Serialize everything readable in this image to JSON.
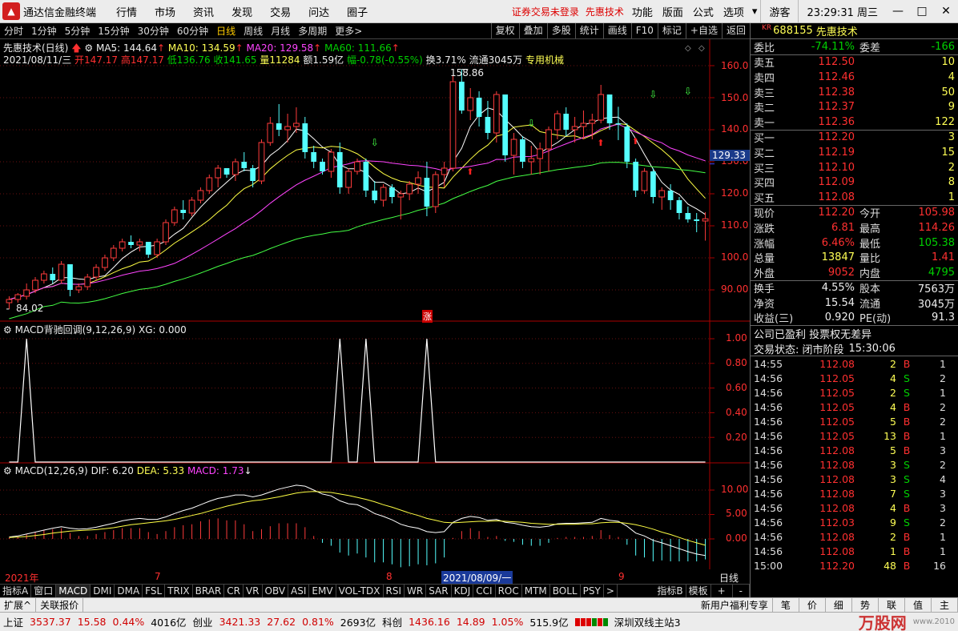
{
  "menubar": {
    "app_name": "通达信金融终端",
    "menus": [
      "行情",
      "市场",
      "资讯",
      "发现",
      "交易",
      "问达",
      "圈子"
    ],
    "warning": "证券交易未登录",
    "stock_name": "先惠技术",
    "tools": [
      "功能",
      "版面",
      "公式",
      "选项"
    ],
    "user": "游客",
    "clock": "23:29:31 周三"
  },
  "chartbar": {
    "periods": [
      "分时",
      "1分钟",
      "5分钟",
      "15分钟",
      "30分钟",
      "60分钟",
      "日线",
      "周线",
      "月线",
      "多周期",
      "更多>"
    ],
    "active_period": "日线",
    "buttons": [
      "复权",
      "叠加",
      "多股",
      "统计",
      "画线",
      "F10",
      "标记",
      "+自选",
      "返回"
    ]
  },
  "main": {
    "title": "先惠技术(日线)",
    "ma5": "MA5: 144.64",
    "ma10": "MA10: 134.59",
    "ma20": "MA20: 129.58",
    "ma60": "MA60: 111.66",
    "quote_date": "2021/08/11/三",
    "open": "开147.17",
    "high": "高147.17",
    "low": "低136.76",
    "close": "收141.65",
    "volume": "量11284",
    "amount": "额1.59亿",
    "change": "幅-0.78(-0.55%)",
    "turnover": "换3.71%",
    "float": "流通3045万",
    "industry": "专用机械",
    "high_mark": "158.86",
    "low_mark": "84.02",
    "rise_mark": "涨",
    "price_axis": [
      "160.0",
      "150.0",
      "140.0",
      "130.0",
      "120.0",
      "110.0",
      "100.0",
      "90.00"
    ],
    "price_tag": "129.33"
  },
  "ind1": {
    "title": "MACD背驰回调(9,12,26,9) XG: 0.000",
    "axis": [
      "1.00",
      "0.80",
      "0.60",
      "0.40",
      "0.20"
    ]
  },
  "ind2": {
    "title": "MACD(12,26,9)",
    "dif": "DIF: 6.20",
    "dea": "DEA: 5.33",
    "macd": "MACD: 1.73",
    "axis": [
      "10.00",
      "5.00",
      "0.00"
    ]
  },
  "xaxis": {
    "labels": [
      "2021年",
      "7",
      "8",
      "9"
    ],
    "cursor_date": "2021/08/09/一",
    "period_label": "日线"
  },
  "rpanel": {
    "code": "688155",
    "name": "先惠技术",
    "kr": "KR",
    "weibi_label": "委比",
    "weibi": "-74.11%",
    "weicha_label": "委差",
    "weicha": "-166",
    "asks": [
      {
        "label": "卖五",
        "price": "112.50",
        "vol": "10"
      },
      {
        "label": "卖四",
        "price": "112.46",
        "vol": "4"
      },
      {
        "label": "卖三",
        "price": "112.38",
        "vol": "50"
      },
      {
        "label": "卖二",
        "price": "112.37",
        "vol": "9"
      },
      {
        "label": "卖一",
        "price": "112.36",
        "vol": "122"
      }
    ],
    "bids": [
      {
        "label": "买一",
        "price": "112.20",
        "vol": "3"
      },
      {
        "label": "买二",
        "price": "112.19",
        "vol": "15"
      },
      {
        "label": "买三",
        "price": "112.10",
        "vol": "2"
      },
      {
        "label": "买四",
        "price": "112.09",
        "vol": "8"
      },
      {
        "label": "买五",
        "price": "112.08",
        "vol": "1"
      }
    ],
    "stats": [
      {
        "l": "现价",
        "v": "112.20",
        "vc": "red",
        "l2": "今开",
        "v2": "105.98",
        "v2c": "red"
      },
      {
        "l": "涨跌",
        "v": "6.81",
        "vc": "red",
        "l2": "最高",
        "v2": "114.26",
        "v2c": "red"
      },
      {
        "l": "涨幅",
        "v": "6.46%",
        "vc": "red",
        "l2": "最低",
        "v2": "105.38",
        "v2c": "green"
      },
      {
        "l": "总量",
        "v": "13847",
        "vc": "yellow",
        "l2": "量比",
        "v2": "1.41",
        "v2c": "red"
      },
      {
        "l": "外盘",
        "v": "9052",
        "vc": "red",
        "l2": "内盘",
        "v2": "4795",
        "v2c": "green"
      }
    ],
    "stats2": [
      {
        "l": "换手",
        "v": "4.55%",
        "l2": "股本",
        "v2": "7563万"
      },
      {
        "l": "净资",
        "v": "15.54",
        "l2": "流通",
        "v2": "3045万"
      },
      {
        "l": "收益(三)",
        "v": "0.920",
        "l2": "PE(动)",
        "v2": "91.3"
      }
    ],
    "notice": "公司已盈利 投票权无差异",
    "status_label": "交易状态: 闭市阶段",
    "status_time": "15:30:06",
    "trades": [
      {
        "t": "14:55",
        "p": "112.08",
        "q": "2",
        "bs": "B",
        "n": "1"
      },
      {
        "t": "14:56",
        "p": "112.05",
        "q": "4",
        "bs": "S",
        "n": "2"
      },
      {
        "t": "14:56",
        "p": "112.05",
        "q": "2",
        "bs": "S",
        "n": "1"
      },
      {
        "t": "14:56",
        "p": "112.05",
        "q": "4",
        "bs": "B",
        "n": "2"
      },
      {
        "t": "14:56",
        "p": "112.05",
        "q": "5",
        "bs": "B",
        "n": "2"
      },
      {
        "t": "14:56",
        "p": "112.05",
        "q": "13",
        "bs": "B",
        "n": "1"
      },
      {
        "t": "14:56",
        "p": "112.08",
        "q": "5",
        "bs": "B",
        "n": "3"
      },
      {
        "t": "14:56",
        "p": "112.08",
        "q": "3",
        "bs": "S",
        "n": "2"
      },
      {
        "t": "14:56",
        "p": "112.08",
        "q": "3",
        "bs": "S",
        "n": "4"
      },
      {
        "t": "14:56",
        "p": "112.08",
        "q": "7",
        "bs": "S",
        "n": "3"
      },
      {
        "t": "14:56",
        "p": "112.08",
        "q": "4",
        "bs": "B",
        "n": "3"
      },
      {
        "t": "14:56",
        "p": "112.03",
        "q": "9",
        "bs": "S",
        "n": "2"
      },
      {
        "t": "14:56",
        "p": "112.08",
        "q": "2",
        "bs": "B",
        "n": "1"
      },
      {
        "t": "14:56",
        "p": "112.08",
        "q": "1",
        "bs": "B",
        "n": "1"
      },
      {
        "t": "15:00",
        "p": "112.20",
        "q": "48",
        "bs": "B",
        "n": "16"
      }
    ]
  },
  "tabs": {
    "items": [
      "指标A",
      "窗口",
      "MACD",
      "DMI",
      "DMA",
      "FSL",
      "TRIX",
      "BRAR",
      "CR",
      "VR",
      "OBV",
      "ASI",
      "EMV",
      "VOL-TDX",
      "RSI",
      "WR",
      "SAR",
      "KDJ",
      "CCI",
      "ROC",
      "MTM",
      "BOLL",
      "PSY",
      ">"
    ],
    "active": "MACD",
    "right": [
      "指标B",
      "模板",
      "+",
      "-"
    ]
  },
  "tabs2": {
    "left": [
      "扩展^",
      "关联报价"
    ],
    "right": [
      "新用户福利专享",
      "笔",
      "价",
      "细",
      "势",
      "联",
      "值",
      "主"
    ]
  },
  "status": {
    "sh_label": "上证",
    "sh": "3537.37",
    "sh_chg": "15.58",
    "sh_pct": "0.44%",
    "sh_amt": "4016亿",
    "cy_label": "创业",
    "cy": "3421.33",
    "cy_chg": "27.62",
    "cy_pct": "0.81%",
    "cy_amt": "2693亿",
    "kc_label": "科创",
    "kc": "1436.16",
    "kc_chg": "14.89",
    "kc_pct": "1.05%",
    "kc_amt": "515.9亿",
    "server": "深圳双线主站3"
  },
  "watermark": {
    "text": "万股网",
    "url": "www.2010"
  },
  "chart_data": {
    "type": "candlestick",
    "ylim": [
      84,
      162
    ],
    "candles": [
      [
        86,
        88,
        84.02,
        87
      ],
      [
        87,
        89,
        86,
        88.5
      ],
      [
        88,
        92,
        87,
        90
      ],
      [
        90,
        94,
        89,
        93
      ],
      [
        93,
        96,
        92,
        95
      ],
      [
        95,
        97,
        92,
        93
      ],
      [
        93,
        99,
        92,
        98
      ],
      [
        98,
        97,
        88,
        90
      ],
      [
        90,
        92,
        89,
        91
      ],
      [
        91,
        95,
        90,
        94
      ],
      [
        94,
        98,
        93,
        97
      ],
      [
        97,
        101,
        96,
        100
      ],
      [
        100,
        104,
        99,
        103
      ],
      [
        103,
        106,
        102,
        105
      ],
      [
        105,
        107,
        103,
        104
      ],
      [
        104,
        106,
        102,
        105
      ],
      [
        105,
        105,
        100,
        101
      ],
      [
        101,
        106,
        100,
        105
      ],
      [
        105,
        112,
        104,
        111
      ],
      [
        111,
        116,
        110,
        115
      ],
      [
        115,
        118,
        112,
        114
      ],
      [
        114,
        119,
        113,
        118
      ],
      [
        118,
        122,
        117,
        121
      ],
      [
        121,
        126,
        120,
        125
      ],
      [
        125,
        129,
        122,
        128
      ],
      [
        128,
        127,
        125,
        126
      ],
      [
        126,
        131,
        124,
        130
      ],
      [
        130,
        133,
        127,
        128
      ],
      [
        128,
        129,
        122,
        124
      ],
      [
        124,
        137,
        123,
        136
      ],
      [
        136,
        144,
        135,
        142
      ],
      [
        142,
        148,
        138,
        140
      ],
      [
        140,
        145,
        136,
        141
      ],
      [
        141,
        147,
        139,
        142
      ],
      [
        142,
        144,
        131,
        133
      ],
      [
        133,
        135,
        128,
        130
      ],
      [
        130,
        131,
        126,
        127
      ],
      [
        127,
        134,
        125,
        133
      ],
      [
        133,
        136,
        120,
        122
      ],
      [
        122,
        128,
        120,
        127
      ],
      [
        127,
        131,
        126,
        130
      ],
      [
        130,
        131,
        119,
        121
      ],
      [
        121,
        124,
        117,
        118
      ],
      [
        118,
        123,
        116,
        122
      ],
      [
        122,
        123,
        117,
        119
      ],
      [
        119,
        121,
        112,
        120
      ],
      [
        120,
        124,
        118,
        123
      ],
      [
        123,
        127,
        120,
        125
      ],
      [
        125,
        130,
        113,
        116
      ],
      [
        116,
        127,
        114,
        126
      ],
      [
        126,
        130,
        122,
        128
      ],
      [
        128,
        157,
        127,
        155
      ],
      [
        155,
        158.86,
        145,
        146
      ],
      [
        146,
        153,
        143,
        150
      ],
      [
        150,
        152,
        141,
        144
      ],
      [
        144,
        149,
        137,
        139
      ],
      [
        139,
        152,
        136,
        151
      ],
      [
        151,
        150,
        130,
        132
      ],
      [
        132,
        139,
        126,
        137
      ],
      [
        137,
        138,
        128,
        130
      ],
      [
        130,
        135,
        126,
        131
      ],
      [
        131,
        136,
        126,
        134
      ],
      [
        134,
        141,
        127,
        140
      ],
      [
        140,
        146,
        137,
        145
      ],
      [
        145,
        147,
        138,
        140
      ],
      [
        140,
        144,
        136,
        141
      ],
      [
        141,
        146,
        137,
        142
      ],
      [
        142,
        145,
        137,
        143
      ],
      [
        143,
        154,
        142,
        151
      ],
      [
        151,
        149,
        140,
        142
      ],
      [
        142,
        147.17,
        136.76,
        141.65
      ],
      [
        141,
        142,
        128,
        130
      ],
      [
        130,
        131,
        119,
        121
      ],
      [
        121,
        128,
        120,
        127
      ],
      [
        127,
        128,
        117,
        119
      ],
      [
        119,
        122,
        115,
        121
      ],
      [
        121,
        123,
        115,
        118
      ],
      [
        118,
        119,
        112,
        114
      ],
      [
        114,
        116,
        111,
        112
      ],
      [
        112,
        114,
        108,
        111.5
      ],
      [
        111.5,
        114.26,
        105.38,
        112.2
      ]
    ],
    "series": [
      {
        "name": "MA5",
        "color": "#ffffff"
      },
      {
        "name": "MA10",
        "color": "#ffff44"
      },
      {
        "name": "MA20",
        "color": "#ff44ff"
      },
      {
        "name": "MA60",
        "color": "#44ff44"
      }
    ],
    "signal_peaks": [
      2,
      38,
      41,
      48
    ],
    "macd": {
      "ylim": [
        -5,
        12
      ],
      "dif": [
        0.4,
        0.6,
        1,
        1.4,
        1.8,
        2.2,
        2.5,
        2.2,
        2,
        2.1,
        2.4,
        2.8,
        3.2,
        3.7,
        4,
        4.2,
        4,
        4,
        4.5,
        5.2,
        5.8,
        6.3,
        7,
        7.7,
        8.3,
        8.6,
        9,
        9,
        8.6,
        9,
        9.6,
        10.2,
        10.6,
        11,
        10.8,
        10,
        9.2,
        8.8,
        7.8,
        7.2,
        7,
        6.2,
        5.2,
        4.6,
        3.9,
        3,
        2.5,
        2.2,
        1.5,
        1.3,
        1.5,
        3.4,
        4.2,
        4.6,
        4.4,
        3.8,
        4,
        3.4,
        3.2,
        2.8,
        2.5,
        2.4,
        2.6,
        3.1,
        3.2,
        3.2,
        3.3,
        3.4,
        4.2,
        3.8,
        3.6,
        2.6,
        1.2,
        0.6,
        -0.3,
        -0.8,
        -1.4,
        -2,
        -2.6,
        -3.1,
        -3.4
      ],
      "dea": [
        0.3,
        0.4,
        0.5,
        0.7,
        0.9,
        1.2,
        1.4,
        1.6,
        1.7,
        1.8,
        1.9,
        2.1,
        2.3,
        2.6,
        2.9,
        3.1,
        3.3,
        3.5,
        3.7,
        4,
        4.4,
        4.8,
        5.2,
        5.7,
        6.2,
        6.7,
        7.1,
        7.5,
        7.8,
        8,
        8.3,
        8.6,
        9,
        9.4,
        9.6,
        9.7,
        9.6,
        9.5,
        9.2,
        8.9,
        8.5,
        8.1,
        7.6,
        7,
        6.5,
        5.9,
        5.3,
        4.8,
        4.2,
        3.8,
        3.4,
        3.3,
        3.4,
        3.5,
        3.6,
        3.6,
        3.7,
        3.6,
        3.5,
        3.4,
        3.2,
        3.1,
        3,
        3,
        3,
        3,
        3.1,
        3.1,
        3.3,
        3.4,
        3.4,
        3.2,
        2.9,
        2.5,
        2,
        1.4,
        0.9,
        0.3,
        -0.3,
        -0.8,
        -1.3
      ]
    }
  }
}
